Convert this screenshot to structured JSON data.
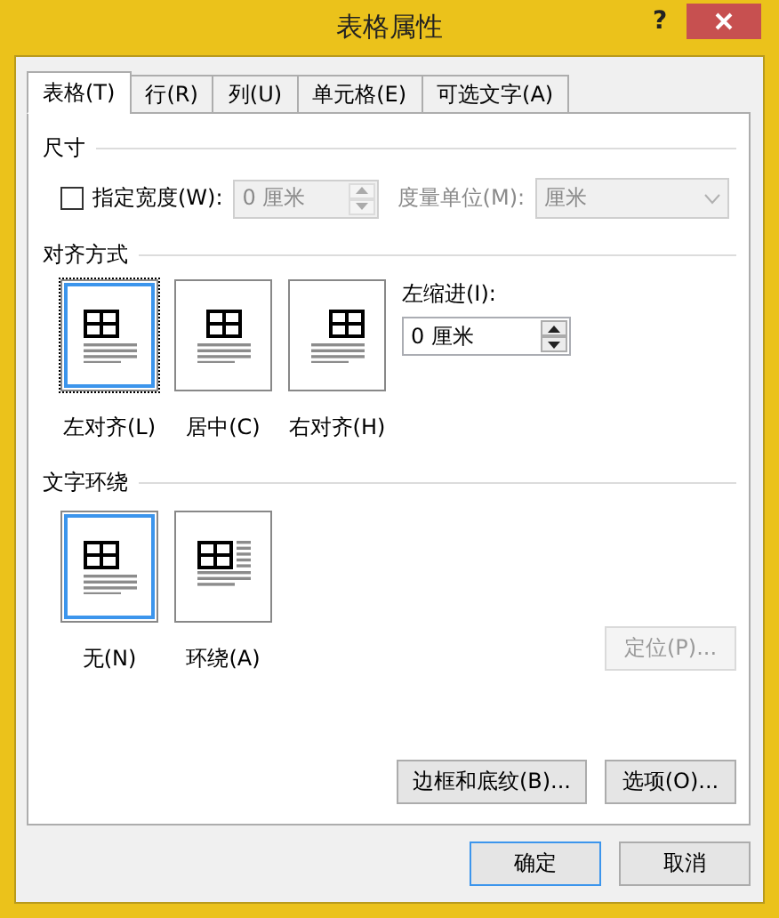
{
  "window": {
    "title": "表格属性",
    "help": "?"
  },
  "tabs": [
    {
      "label": "表格(T)",
      "selected": true
    },
    {
      "label": "行(R)",
      "selected": false
    },
    {
      "label": "列(U)",
      "selected": false
    },
    {
      "label": "单元格(E)",
      "selected": false
    },
    {
      "label": "可选文字(A)",
      "selected": false
    }
  ],
  "size": {
    "heading": "尺寸",
    "specify_width": {
      "label": "指定宽度(W):",
      "checked": false
    },
    "width_field": {
      "value": "0 厘米",
      "disabled": true
    },
    "unit_label": "度量单位(M):",
    "unit_select": {
      "value": "厘米",
      "disabled": true
    }
  },
  "alignment": {
    "heading": "对齐方式",
    "options": [
      {
        "kind": "left",
        "label": "左对齐(L)",
        "selected": true,
        "focused": true
      },
      {
        "kind": "center",
        "label": "居中(C)",
        "selected": false,
        "focused": false
      },
      {
        "kind": "right",
        "label": "右对齐(H)",
        "selected": false,
        "focused": false
      }
    ],
    "indent_label": "左缩进(I):",
    "indent_field": {
      "value": "0 厘米",
      "disabled": false
    }
  },
  "wrapping": {
    "heading": "文字环绕",
    "options": [
      {
        "kind": "none",
        "label": "无(N)",
        "selected": true,
        "focused": false
      },
      {
        "kind": "around",
        "label": "环绕(A)",
        "selected": false,
        "focused": false
      }
    ],
    "position_button": {
      "label": "定位(P)...",
      "disabled": true
    }
  },
  "panel_buttons": [
    {
      "label": "边框和底纹(B)..."
    },
    {
      "label": "选项(O)..."
    }
  ],
  "footer_buttons": [
    {
      "label": "确定",
      "default": true
    },
    {
      "label": "取消",
      "default": false
    }
  ]
}
